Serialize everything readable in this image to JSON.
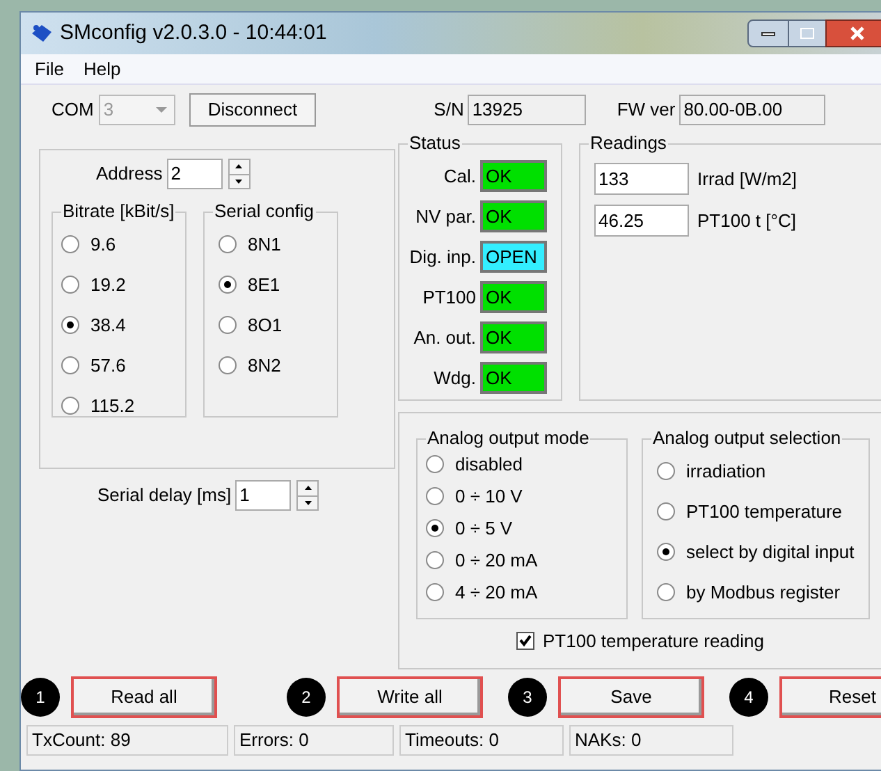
{
  "window": {
    "title": "SMconfig v2.0.3.0 - 10:44:01"
  },
  "menu": [
    "File",
    "Help"
  ],
  "connection": {
    "com_label": "COM",
    "com_value": "3",
    "disconnect": "Disconnect",
    "sn_label": "S/N",
    "sn_value": "13925",
    "fw_label": "FW ver",
    "fw_value": "80.00-0B.00"
  },
  "address": {
    "label": "Address",
    "value": "2"
  },
  "bitrate": {
    "title": "Bitrate [kBit/s]",
    "options": [
      {
        "label": "9.6",
        "selected": false
      },
      {
        "label": "19.2",
        "selected": false
      },
      {
        "label": "38.4",
        "selected": true
      },
      {
        "label": "57.6",
        "selected": false
      },
      {
        "label": "115.2",
        "selected": false
      }
    ]
  },
  "serial_config": {
    "title": "Serial config",
    "options": [
      {
        "label": "8N1",
        "selected": false
      },
      {
        "label": "8E1",
        "selected": true
      },
      {
        "label": "8O1",
        "selected": false
      },
      {
        "label": "8N2",
        "selected": false
      }
    ]
  },
  "serial_delay": {
    "label": "Serial delay [ms]",
    "value": "1"
  },
  "status": {
    "title": "Status",
    "items": [
      {
        "label": "Cal.",
        "value": "OK",
        "color": "#00e000"
      },
      {
        "label": "NV par.",
        "value": "OK",
        "color": "#00e000"
      },
      {
        "label": "Dig. inp.",
        "value": "OPEN",
        "color": "#33eeff"
      },
      {
        "label": "PT100",
        "value": "OK",
        "color": "#00e000"
      },
      {
        "label": "An. out.",
        "value": "OK",
        "color": "#00e000"
      },
      {
        "label": "Wdg.",
        "value": "OK",
        "color": "#00e000"
      }
    ]
  },
  "readings": {
    "title": "Readings",
    "items": [
      {
        "value": "133",
        "label": "Irrad [W/m2]"
      },
      {
        "value": "46.25",
        "label": "PT100 t [°C]"
      }
    ]
  },
  "analog_output_mode": {
    "title": "Analog output mode",
    "options": [
      {
        "label": "disabled",
        "selected": false
      },
      {
        "label": "0 ÷ 10 V",
        "selected": false
      },
      {
        "label": "0 ÷ 5 V",
        "selected": true
      },
      {
        "label": "0 ÷ 20 mA",
        "selected": false
      },
      {
        "label": "4 ÷ 20 mA",
        "selected": false
      }
    ]
  },
  "analog_output_selection": {
    "title": "Analog output selection",
    "options": [
      {
        "label": "irradiation",
        "selected": false
      },
      {
        "label": "PT100 temperature",
        "selected": false
      },
      {
        "label": "select by digital input",
        "selected": true
      },
      {
        "label": "by Modbus register",
        "selected": false
      }
    ]
  },
  "pt100_reading": {
    "label": "PT100 temperature reading",
    "checked": true
  },
  "buttons": [
    {
      "marker": "1",
      "label": "Read all"
    },
    {
      "marker": "2",
      "label": "Write all"
    },
    {
      "marker": "3",
      "label": "Save"
    },
    {
      "marker": "4",
      "label": "Reset"
    }
  ],
  "status_bar": [
    "TxCount: 89",
    "Errors: 0",
    "Timeouts: 0",
    "NAKs: 0"
  ]
}
